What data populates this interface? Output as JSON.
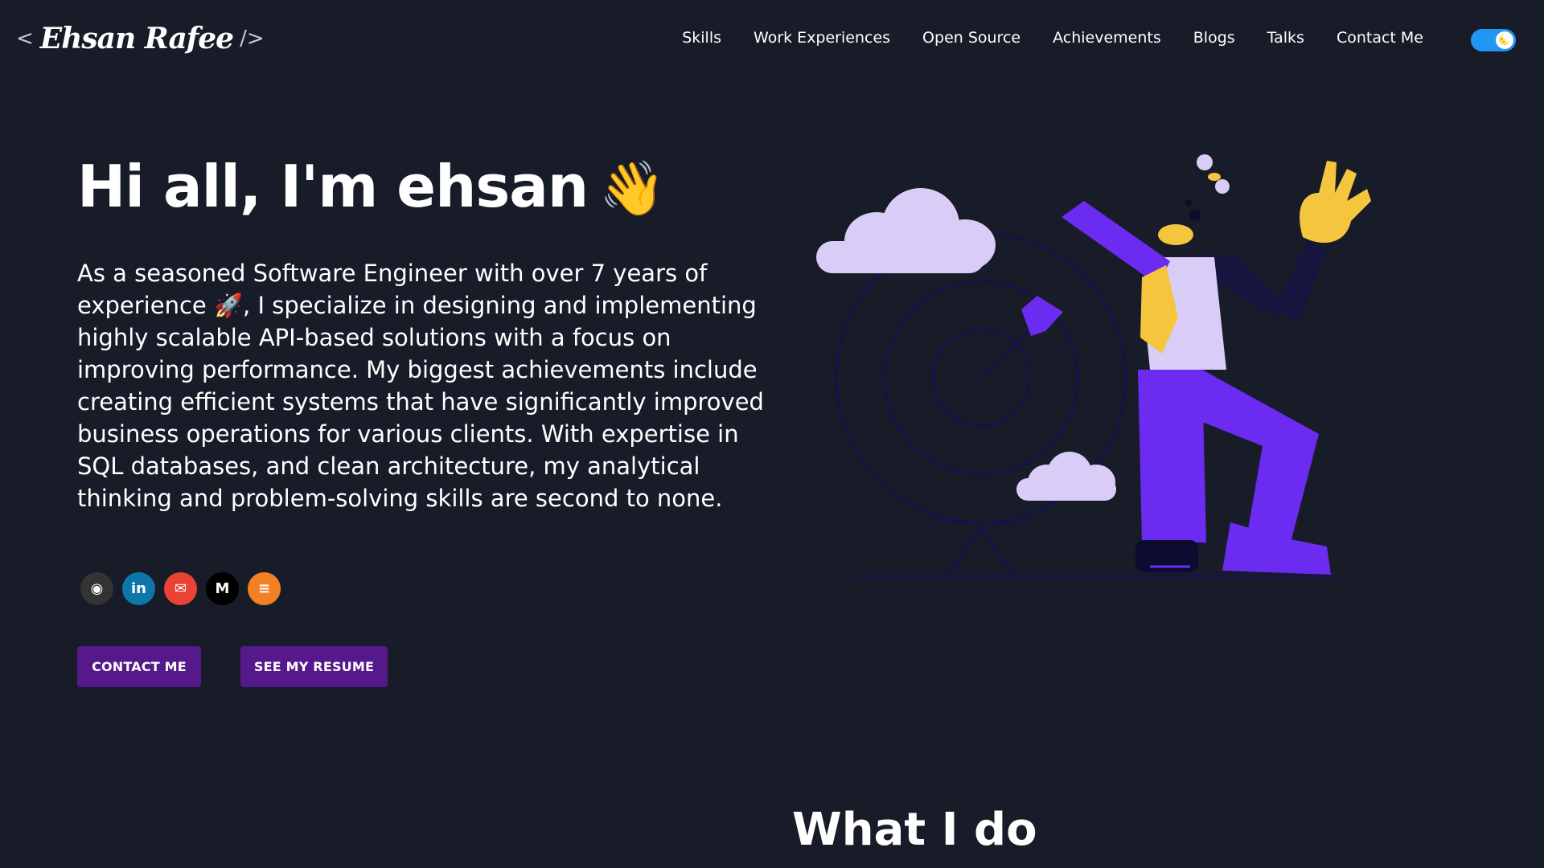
{
  "header": {
    "logo": {
      "open": "<",
      "signature": "Ehsan Rafee",
      "close": "/>"
    },
    "nav": [
      "Skills",
      "Work Experiences",
      "Open Source",
      "Achievements",
      "Blogs",
      "Talks",
      "Contact Me"
    ],
    "theme_toggle": {
      "state": "dark",
      "knob_glyph": "🌜"
    }
  },
  "hero": {
    "greeting": "Hi all, I'm ehsan",
    "wave_emoji": "👋",
    "bio": "As a seasoned Software Engineer with over 7 years of experience 🚀, I specialize in designing and implementing highly scalable API-based solutions with a focus on improving performance. My biggest achievements include creating efficient systems that have significantly improved business operations for various clients. With expertise in SQL databases, and clean architecture, my analytical thinking and problem-solving skills are second to none.",
    "socials": [
      {
        "name": "github",
        "glyph": "◉",
        "color": "#333333"
      },
      {
        "name": "linkedin",
        "glyph": "in",
        "color": "#0e76a8"
      },
      {
        "name": "gmail",
        "glyph": "✉",
        "color": "#ea4335"
      },
      {
        "name": "medium",
        "glyph": "M",
        "color": "#000000"
      },
      {
        "name": "stackoverflow",
        "glyph": "≡",
        "color": "#f48024"
      }
    ],
    "buttons": {
      "contact": "CONTACT ME",
      "resume": "SEE MY RESUME"
    }
  },
  "sections": {
    "what_i_do": "What I do"
  },
  "colors": {
    "background": "#171c28",
    "button": "#55198b",
    "toggle": "#2196f3",
    "illustration_purple": "#6c2bf0",
    "illustration_lilac": "#d9cdf7",
    "illustration_yellow": "#f5c53d"
  }
}
